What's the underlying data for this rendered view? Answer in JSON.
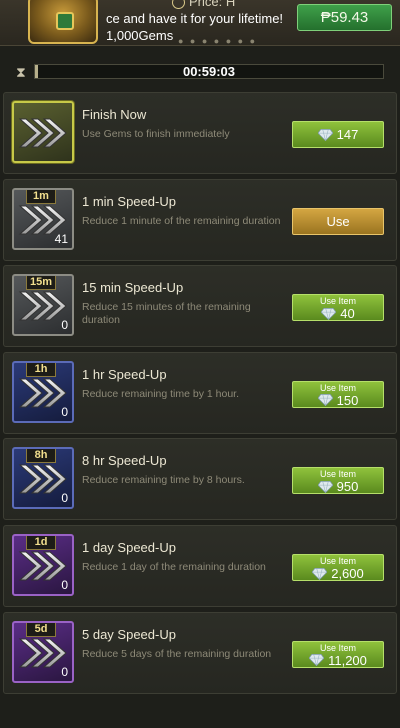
{
  "banner": {
    "top_label": "Price: H",
    "promo_text": "ce and have it for your lifetime!",
    "gems_text": "1,000Gems",
    "dots": "● ● ● ● ● ● ●",
    "price": "₱59.43"
  },
  "timer": {
    "time": "00:59:03",
    "progress_fraction": 0.01
  },
  "items": [
    {
      "title": "Finish Now",
      "desc": "Use Gems to finish immediately",
      "tag": "",
      "count": "",
      "frame": "gold",
      "button_style": "green",
      "button_small": "",
      "button_value": "147",
      "show_gem": true
    },
    {
      "title": "1 min Speed-Up",
      "desc": "Reduce 1 minute of the remaining duration",
      "tag": "1m",
      "count": "41",
      "frame": "silver",
      "button_style": "orange",
      "button_small": "",
      "button_value": "Use",
      "show_gem": false
    },
    {
      "title": "15 min Speed-Up",
      "desc": "Reduce 15 minutes of the remaining duration",
      "tag": "15m",
      "count": "0",
      "frame": "silver",
      "button_style": "green",
      "button_small": "Use Item",
      "button_value": "40",
      "show_gem": true
    },
    {
      "title": "1 hr Speed-Up",
      "desc": "Reduce remaining time by 1 hour.",
      "tag": "1h",
      "count": "0",
      "frame": "blue",
      "button_style": "green",
      "button_small": "Use Item",
      "button_value": "150",
      "show_gem": true
    },
    {
      "title": "8 hr Speed-Up",
      "desc": "Reduce remaining time by 8 hours.",
      "tag": "8h",
      "count": "0",
      "frame": "blue",
      "button_style": "green",
      "button_small": "Use Item",
      "button_value": "950",
      "show_gem": true
    },
    {
      "title": "1 day Speed-Up",
      "desc": "Reduce 1 day of the remaining duration",
      "tag": "1d",
      "count": "0",
      "frame": "purple",
      "button_style": "green",
      "button_small": "Use Item",
      "button_value": "2,600",
      "show_gem": true
    },
    {
      "title": "5 day Speed-Up",
      "desc": "Reduce 5 days of the remaining duration",
      "tag": "5d",
      "count": "0",
      "frame": "purple",
      "button_style": "green",
      "button_small": "Use Item",
      "button_value": "11,200",
      "show_gem": true
    }
  ]
}
